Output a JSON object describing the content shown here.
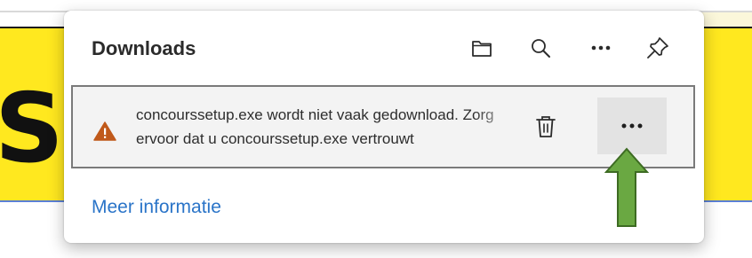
{
  "panel": {
    "title": "Downloads",
    "toolbar_icons": [
      "folder-icon",
      "search-icon",
      "more-icon",
      "pin-icon"
    ]
  },
  "download_item": {
    "status_icon": "warning-icon",
    "message_line1": "concourssetup.exe wordt niet vaak gedownload. Zorg",
    "message_line2": "ervoor dat u concourssetup.exe vertrouwt",
    "actions": [
      "delete-icon",
      "more-icon"
    ]
  },
  "footer": {
    "link_label": "Meer informatie"
  },
  "colors": {
    "banner": "#ffe81f",
    "warning": "#c0591a",
    "link": "#2a74c8",
    "annotation_arrow": "#6aa842"
  },
  "background_page": {
    "large_letter": "S"
  }
}
